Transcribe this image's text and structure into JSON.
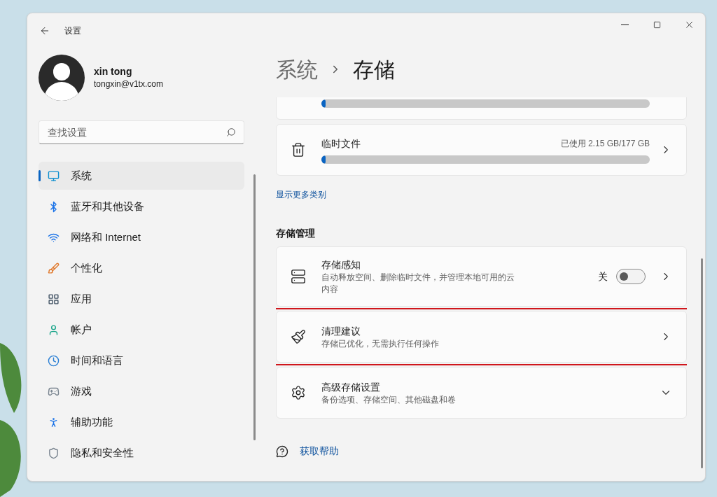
{
  "window": {
    "title": "设置"
  },
  "user": {
    "name": "xin tong",
    "email": "tongxin@v1tx.com"
  },
  "search": {
    "placeholder": "查找设置"
  },
  "nav": [
    {
      "label": "系统",
      "selected": true
    },
    {
      "label": "蓝牙和其他设备",
      "selected": false
    },
    {
      "label": "网络和 Internet",
      "selected": false
    },
    {
      "label": "个性化",
      "selected": false
    },
    {
      "label": "应用",
      "selected": false
    },
    {
      "label": "帐户",
      "selected": false
    },
    {
      "label": "时间和语言",
      "selected": false
    },
    {
      "label": "游戏",
      "selected": false
    },
    {
      "label": "辅助功能",
      "selected": false
    },
    {
      "label": "隐私和安全性",
      "selected": false
    }
  ],
  "breadcrumb": [
    "系统",
    "存储"
  ],
  "storage_categories": [
    {
      "level": 0.012
    },
    {
      "label": "临时文件",
      "usage": "已使用 2.15 GB/177 GB",
      "level": 0.012
    }
  ],
  "more_link": "显示更多类别",
  "section_title": "存储管理",
  "settings": [
    {
      "kind": "toggle",
      "title": "存储感知",
      "description": "自动释放空间、删除临时文件，并管理本地可用的云内容",
      "toggle_label": "关",
      "on": false,
      "highlighted": false
    },
    {
      "kind": "link",
      "title": "清理建议",
      "description": "存储已优化，无需执行任何操作",
      "highlighted": true
    },
    {
      "kind": "expander",
      "title": "高级存储设置",
      "description": "备份选项、存储空间、其他磁盘和卷",
      "highlighted": false
    }
  ],
  "help_link": "获取帮助"
}
